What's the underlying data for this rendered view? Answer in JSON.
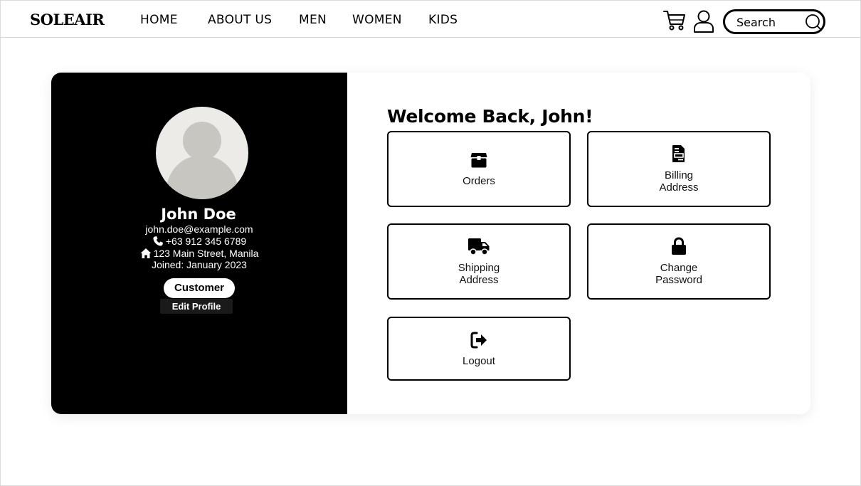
{
  "header": {
    "brand": "SOLEAIR",
    "nav": [
      "HOME",
      "ABOUT US",
      "MEN",
      "WOMEN",
      "KIDS"
    ],
    "search_placeholder": "Search",
    "icons": [
      "cart-icon",
      "user-icon",
      "search-icon"
    ]
  },
  "profile": {
    "name": "John Doe",
    "email": "john.doe@example.com",
    "phone": "+63 912 345 6789",
    "address": "123 Main Street, Manila",
    "joined": "Joined: January 2023",
    "role": "Customer",
    "edit_label": "Edit Profile"
  },
  "main": {
    "welcome": "Welcome Back, John!",
    "tiles": [
      {
        "label": "Orders",
        "icon": "box-icon"
      },
      {
        "label_line1": "Billing",
        "label_line2": "Address",
        "icon": "file-icon"
      },
      {
        "label_line1": "Shipping",
        "label_line2": "Address",
        "icon": "truck-icon"
      },
      {
        "label_line1": "Change",
        "label_line2": "Password",
        "icon": "lock-icon"
      },
      {
        "label": "Logout",
        "icon": "logout-icon"
      }
    ]
  },
  "colors": {
    "panel": "#000000",
    "avatar_bg": "#ecebe8",
    "avatar_fg": "#c8c6c1"
  }
}
